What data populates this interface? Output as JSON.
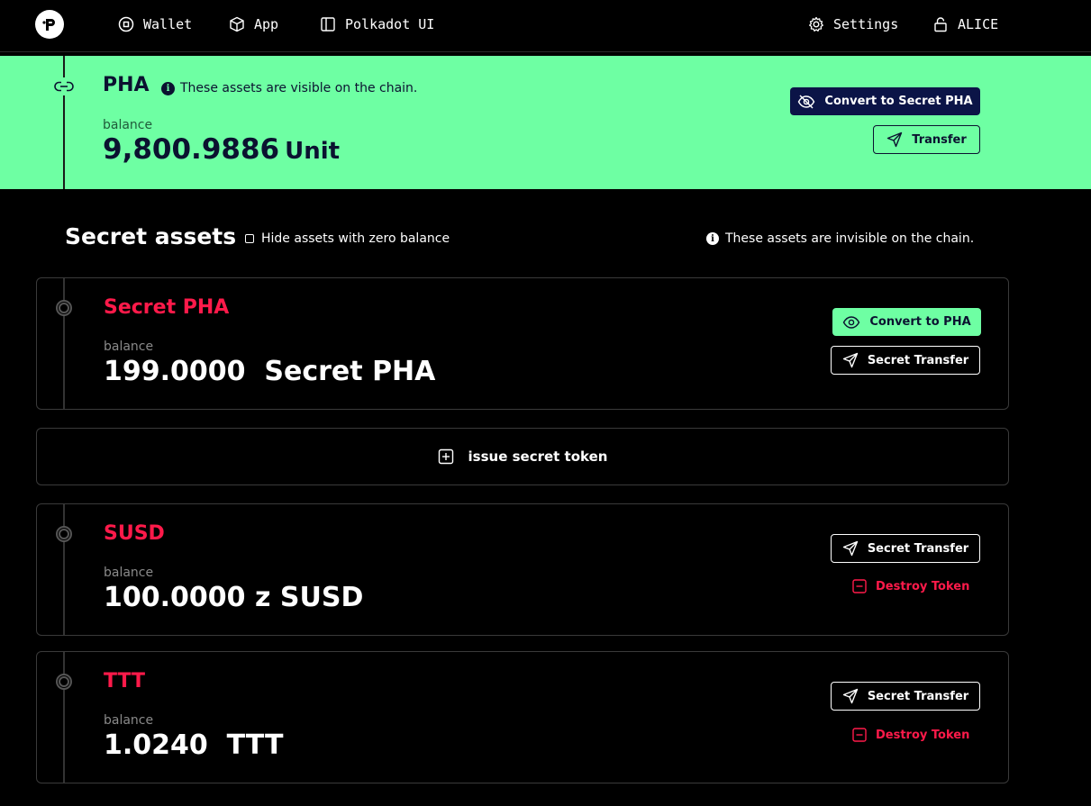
{
  "nav": {
    "items": [
      {
        "label": "Wallet",
        "icon": "circle-square-icon"
      },
      {
        "label": "App",
        "icon": "cube-icon"
      },
      {
        "label": "Polkadot UI",
        "icon": "sidebar-panel-icon"
      }
    ],
    "settings_label": "Settings",
    "account_label": "ALICE"
  },
  "public_asset": {
    "title": "PHA",
    "note": "These assets are visible on the chain.",
    "balance_label": "balance",
    "balance_value": "9,800.9886",
    "balance_unit": "Unit",
    "convert_label": "Convert to Secret PHA",
    "transfer_label": "Transfer"
  },
  "secret": {
    "title": "Secret assets",
    "hide_zero_label": "Hide assets with zero balance",
    "note": "These assets are invisible on the chain.",
    "issue_label": "issue secret token",
    "assets": [
      {
        "name": "Secret PHA",
        "balance_label": "balance",
        "balance": "199.0000  Secret PHA",
        "convert_label": "Convert to PHA",
        "transfer_label": "Secret Transfer"
      },
      {
        "name": "SUSD",
        "balance_label": "balance",
        "balance": "100.0000 z SUSD",
        "transfer_label": "Secret Transfer",
        "destroy_label": "Destroy Token"
      },
      {
        "name": "TTT",
        "balance_label": "balance",
        "balance": "1.0240  TTT",
        "transfer_label": "Secret Transfer",
        "destroy_label": "Destroy Token"
      }
    ]
  },
  "colors": {
    "accent_green": "#6effa3",
    "secret_red": "#ff1a4a",
    "navy": "#0b1447"
  }
}
